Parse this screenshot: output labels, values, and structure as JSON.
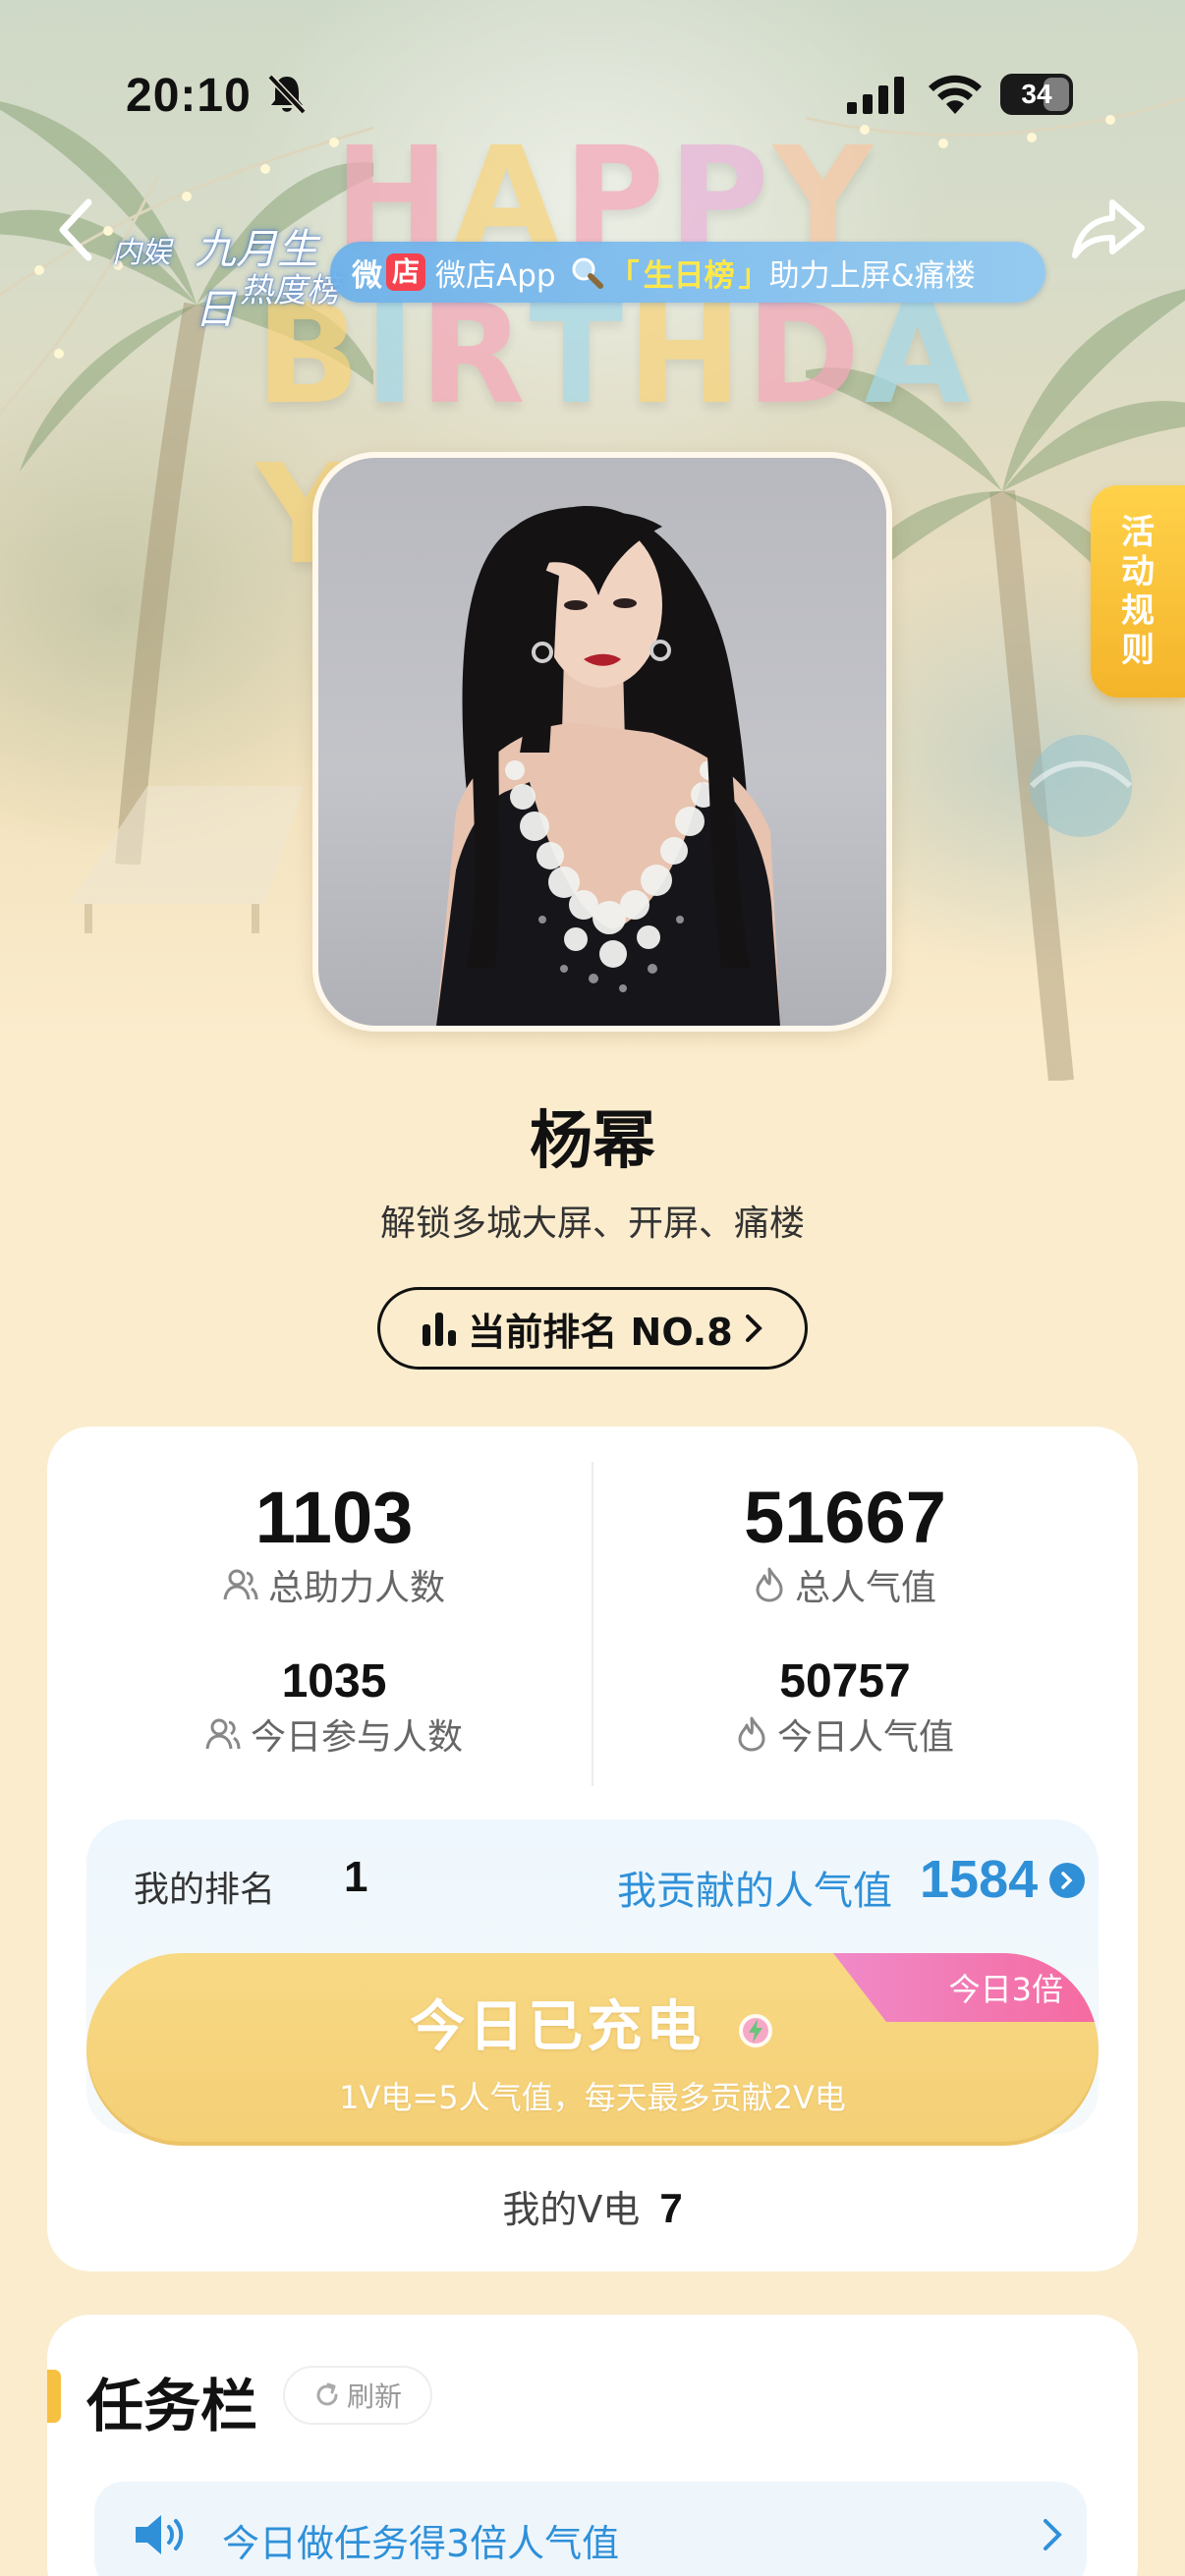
{
  "status_bar": {
    "time": "20:10",
    "battery": "34"
  },
  "header": {
    "event_logo": {
      "line1": "内娱",
      "line2": "九月生日",
      "line3": "热度榜"
    },
    "happy_letters": [
      "H",
      "A",
      "P",
      "P",
      "Y"
    ],
    "birthday_letters": [
      "B",
      "I",
      "R",
      "T",
      "H",
      "D",
      "A",
      "Y"
    ],
    "promo": {
      "weidian": "微",
      "shop_badge": "店",
      "app_text": "微店App",
      "open_bracket": "「",
      "rank_name": "生日榜",
      "close_bracket": "」",
      "suffix": "助力上屏&痛楼"
    }
  },
  "rules_tab": {
    "label": "活动规则"
  },
  "profile": {
    "name": "杨幂",
    "unlock_text": "解锁多城大屏、开屏、痛楼",
    "rank_pill": "当前排名 NO.8"
  },
  "stats": {
    "total_supporters": {
      "value": "1103",
      "label": "总助力人数"
    },
    "total_popularity": {
      "value": "51667",
      "label": "总人气值"
    },
    "today_participants": {
      "value": "1035",
      "label": "今日参与人数"
    },
    "today_popularity": {
      "value": "50757",
      "label": "今日人气值"
    }
  },
  "contribution": {
    "my_rank_label": "我的排名",
    "my_rank_value": "1",
    "contrib_label": "我贡献的人气值",
    "contrib_value": "1584",
    "charge_title": "今日已充电",
    "charge_sub": "1V电=5人气值，每天最多贡献2V电",
    "triple_badge": "今日3倍",
    "my_v_label": "我的V电",
    "my_v_value": "7"
  },
  "tasks": {
    "title": "任务栏",
    "refresh": "刷新",
    "banner": "今日做任务得3倍人气值"
  },
  "colors": {
    "accent_blue": "#2f90d8",
    "accent_yellow": "#f6c040",
    "charge_yellow": "#f4cf76",
    "badge_pink": "#f56aa0"
  }
}
